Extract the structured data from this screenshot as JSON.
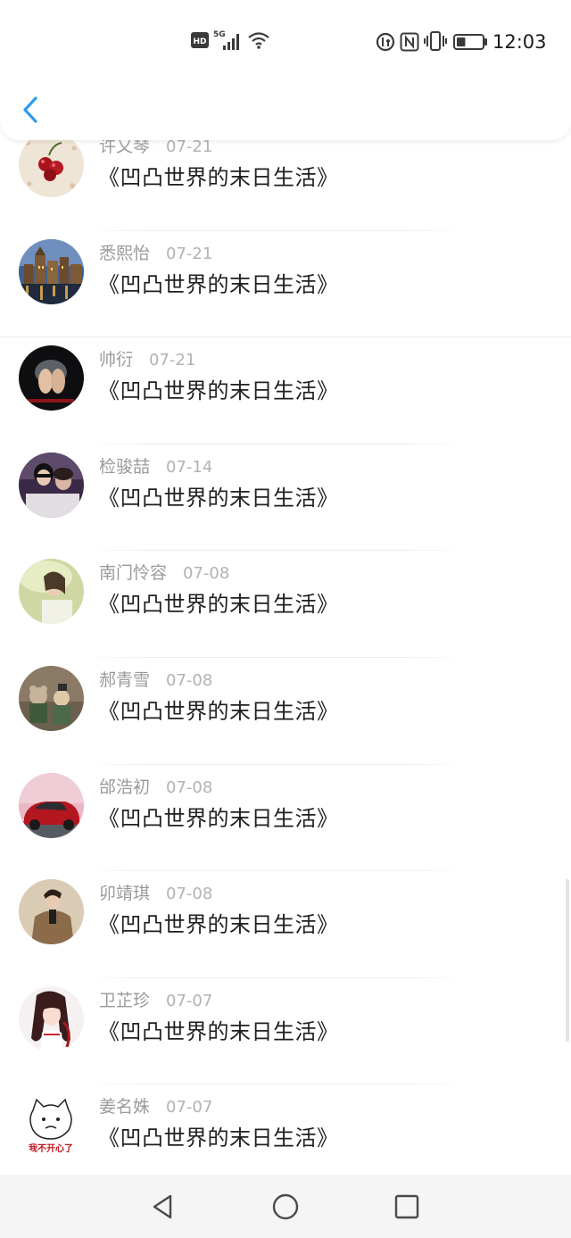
{
  "status_bar": {
    "time": "12:03",
    "left_badges": [
      "hd-badge",
      "5g-signal-icon",
      "wifi-icon"
    ],
    "right_icons": [
      "data-saver-icon",
      "nfc-icon",
      "vibrate-icon",
      "battery-icon"
    ],
    "battery_level_percent": 35
  },
  "header": {
    "back_icon": "chevron-left-icon"
  },
  "items": [
    {
      "name": "许又琴",
      "date": "07-21",
      "title": "《凹凸世界的末日生活》",
      "avatar": "cherries"
    },
    {
      "name": "悉熙怡",
      "date": "07-21",
      "title": "《凹凸世界的末日生活》",
      "avatar": "city-night"
    },
    {
      "name": "帅衍",
      "date": "07-21",
      "title": "《凹凸世界的末日生活》",
      "avatar": "dark-hands"
    },
    {
      "name": "检骏喆",
      "date": "07-14",
      "title": "《凹凸世界的末日生活》",
      "avatar": "couple"
    },
    {
      "name": "南门怜容",
      "date": "07-08",
      "title": "《凹凸世界的末日生活》",
      "avatar": "girl-green"
    },
    {
      "name": "郝青雪",
      "date": "07-08",
      "title": "《凹凸世界的末日生活》",
      "avatar": "cartoon-bear"
    },
    {
      "name": "邰浩初",
      "date": "07-08",
      "title": "《凹凸世界的末日生活》",
      "avatar": "red-car"
    },
    {
      "name": "卯靖琪",
      "date": "07-08",
      "title": "《凹凸世界的末日生活》",
      "avatar": "man-coat"
    },
    {
      "name": "卫芷珍",
      "date": "07-07",
      "title": "《凹凸世界的末日生活》",
      "avatar": "anime-girl"
    },
    {
      "name": "姜名姝",
      "date": "07-07",
      "title": "《凹凸世界的末日生活》",
      "avatar": "sad-cat",
      "avatar_caption": "我不开心了"
    }
  ],
  "nav_bar": {
    "buttons": [
      "back-triangle-icon",
      "home-circle-icon",
      "recents-square-icon"
    ]
  },
  "colors": {
    "accent": "#2f9cf0",
    "name_text": "#9a9a9a",
    "date_text": "#b2b2b2",
    "title_text": "#1f1f1f",
    "nav_bg": "#f5f5f5"
  }
}
